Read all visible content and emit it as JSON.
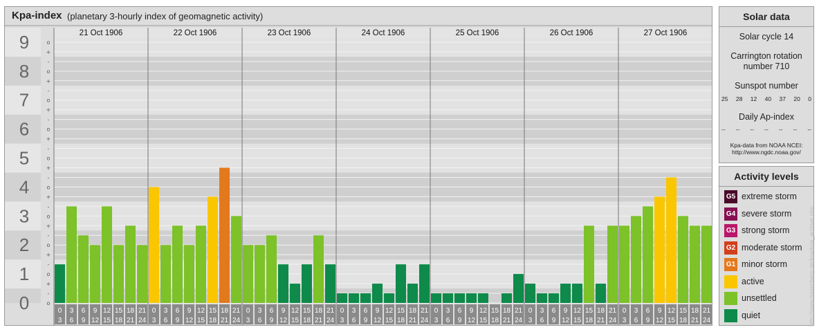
{
  "title": {
    "main": "Kpa-index",
    "subtitle": "(planetary 3-hourly index of geomagnetic activity)"
  },
  "chart_data": {
    "type": "bar",
    "y_ticks": [
      "0",
      "1",
      "2",
      "3",
      "4",
      "5",
      "6",
      "7",
      "8",
      "9"
    ],
    "sub_ticks": [
      "o",
      "+",
      "-",
      "o",
      "+",
      "-",
      "o",
      "+",
      "-",
      "o",
      "+",
      "-",
      "o",
      "+",
      "-",
      "o",
      "+",
      "-",
      "o",
      "+",
      "-",
      "o",
      "+",
      "-",
      "o",
      "+",
      "-",
      "o"
    ],
    "ylim": [
      0,
      9
    ],
    "days": [
      "21 Oct 1906",
      "22 Oct 1906",
      "23 Oct 1906",
      "24 Oct 1906",
      "25 Oct 1906",
      "26 Oct 1906",
      "27 Oct 1906"
    ],
    "hour_start": [
      "0",
      "3",
      "6",
      "9",
      "12",
      "15",
      "18",
      "21"
    ],
    "hour_end": [
      "3",
      "6",
      "9",
      "12",
      "15",
      "18",
      "21",
      "24"
    ],
    "values": [
      1.333,
      3.333,
      2.333,
      2.0,
      3.333,
      2.0,
      2.667,
      2.0,
      4.0,
      2.0,
      2.667,
      2.0,
      2.667,
      3.667,
      4.667,
      3.0,
      2.0,
      2.0,
      2.333,
      1.333,
      0.667,
      1.333,
      2.333,
      1.333,
      0.333,
      0.333,
      0.333,
      0.667,
      0.333,
      1.333,
      0.667,
      1.333,
      0.333,
      0.333,
      0.333,
      0.333,
      0.333,
      0.0,
      0.333,
      1.0,
      0.667,
      0.333,
      0.333,
      0.667,
      0.667,
      2.667,
      0.667,
      2.667,
      2.667,
      3.0,
      3.333,
      3.667,
      4.333,
      3.0,
      2.667,
      2.667
    ],
    "level_colors": {
      "quiet": "#0e8a4a",
      "unsettled": "#7cc228",
      "active": "#fac600",
      "minor": "#e3791d",
      "moderate": "#d1401b",
      "strong": "#b8176a",
      "severe": "#861052",
      "extreme": "#4a0a29"
    }
  },
  "solar": {
    "title": "Solar data",
    "cycle": "Solar cycle 14",
    "carrington_1": "Carrington rotation",
    "carrington_2": "number 710",
    "sunspot_label": "Sunspot number",
    "sunspots": [
      "25",
      "28",
      "12",
      "40",
      "37",
      "20",
      "0"
    ],
    "ap_label": "Daily Ap-index",
    "ap_values": [
      "--",
      "--",
      "--",
      "--",
      "--",
      "--",
      "--"
    ],
    "source_1": "Kpa-data from NOAA NCEI:",
    "source_2": "http://www.ngdc.noaa.gov/"
  },
  "activity": {
    "title": "Activity levels",
    "items": [
      {
        "code": "G5",
        "label": "extreme storm",
        "color": "#4a0a29"
      },
      {
        "code": "G4",
        "label": "severe storm",
        "color": "#861052"
      },
      {
        "code": "G3",
        "label": "strong storm",
        "color": "#b8176a"
      },
      {
        "code": "G2",
        "label": "moderate storm",
        "color": "#d1401b"
      },
      {
        "code": "G1",
        "label": "minor storm",
        "color": "#e3791d"
      },
      {
        "code": "",
        "label": "active",
        "color": "#fac600"
      },
      {
        "code": "",
        "label": "unsettled",
        "color": "#7cc228"
      },
      {
        "code": "",
        "label": "quiet",
        "color": "#0e8a4a"
      }
    ]
  },
  "credit": "http://www.tiesenberg.de/kpa/kpa_archive.php"
}
